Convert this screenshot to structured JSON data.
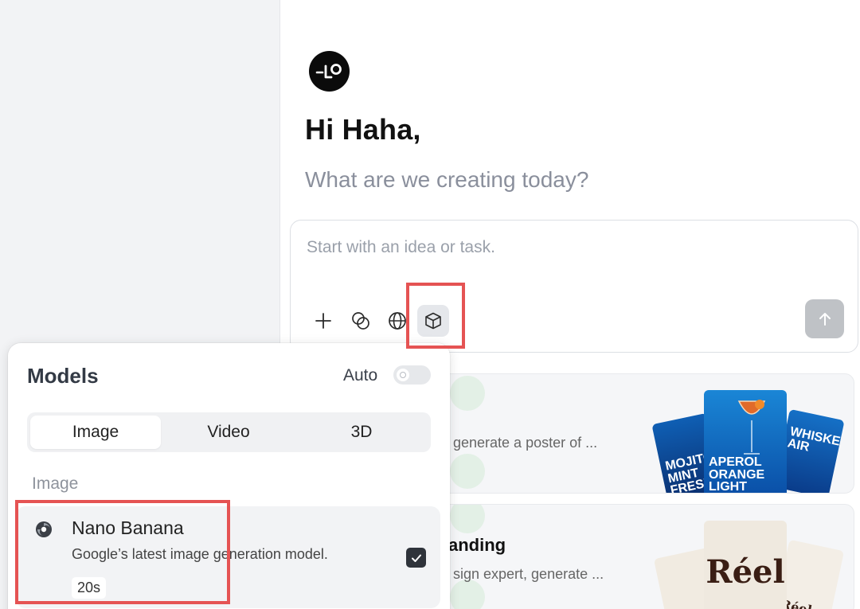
{
  "greeting": "Hi Haha,",
  "subgreeting": "What are we creating today?",
  "composer": {
    "placeholder": "Start with an idea or task.",
    "tools": [
      "plus-icon",
      "blend-icon",
      "globe-icon",
      "cube-icon"
    ],
    "send_icon": "arrow-up-icon"
  },
  "cards": [
    {
      "title": "",
      "description": "generate a poster of ...",
      "posters": [
        "MOJITO MINT FRESH",
        "APEROL ORANGE LIGHT",
        "WHISKEY AIR"
      ]
    },
    {
      "title": "anding",
      "description": "sign expert, generate ...",
      "posters": [
        "Ré",
        "Réel",
        "Réel"
      ]
    }
  ],
  "models_panel": {
    "title": "Models",
    "auto_label": "Auto",
    "auto_enabled": false,
    "tabs": [
      "Image",
      "Video",
      "3D"
    ],
    "active_tab": "Image",
    "section_label": "Image",
    "models": [
      {
        "name": "Nano Banana",
        "description": "Google’s latest image generation model.",
        "badge": "20s",
        "selected": true
      }
    ]
  },
  "colors": {
    "highlight": "#e55353",
    "sidebar_bg": "#f2f3f5",
    "send_disabled": "#bfc2c6"
  }
}
